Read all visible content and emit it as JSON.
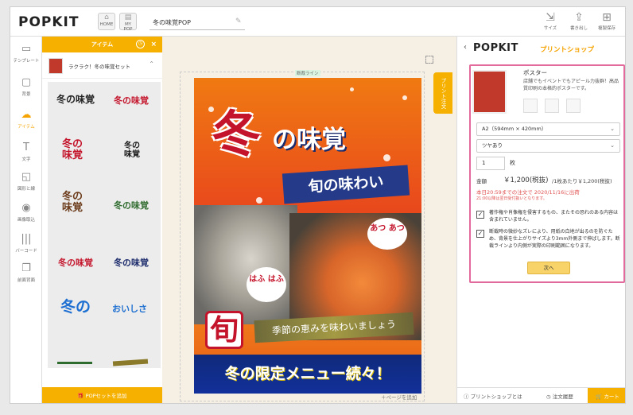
{
  "header": {
    "logo": "POPKIT",
    "home_label": "HOME",
    "mypop_label": "MY POP",
    "doc_title": "冬の味覚POP",
    "tools": [
      {
        "label": "サイズ",
        "icon": "resize-icon"
      },
      {
        "label": "書き出し",
        "icon": "export-icon"
      },
      {
        "label": "複製保存",
        "icon": "duplicate-icon"
      }
    ]
  },
  "rail": {
    "items": [
      {
        "label": "テンプレート",
        "icon": "template-icon",
        "active": false
      },
      {
        "label": "背景",
        "icon": "background-icon",
        "active": false
      },
      {
        "label": "アイテム",
        "icon": "item-icon",
        "active": true
      },
      {
        "label": "文字",
        "icon": "text-icon",
        "active": false
      },
      {
        "label": "図形と線",
        "icon": "shape-icon",
        "active": false
      },
      {
        "label": "画像取込",
        "icon": "image-import-icon",
        "active": false
      },
      {
        "label": "バーコード",
        "icon": "barcode-icon",
        "active": false
      },
      {
        "label": "前面背面",
        "icon": "layer-order-icon",
        "active": false
      }
    ]
  },
  "panel": {
    "title": "アイテム",
    "set_label": "ラクラク！冬の味覚セット",
    "footer": "POPセットを追加",
    "stickers": [
      {
        "text": "冬の味覚",
        "color": "#222222"
      },
      {
        "text": "冬の味覚",
        "color": "#c4142b"
      },
      {
        "text": "冬の味覚",
        "color": "#c4142b"
      },
      {
        "text": "冬の味覚",
        "color": "#1a1a1a"
      },
      {
        "text": "冬の味覚",
        "color": "#6b3b1b"
      },
      {
        "text": "冬の味覚",
        "color": "#2e6b2e"
      },
      {
        "text": "冬の味覚",
        "color": "#c4142b"
      },
      {
        "text": "冬の味覚",
        "color": "#1b2a6b"
      },
      {
        "text": "冬の",
        "color": "#1d6fd1"
      },
      {
        "text": "おいしさ",
        "color": "#1d6fd1"
      }
    ]
  },
  "canvas": {
    "trim_label": "断裁ライン",
    "side_tab": "プリント注文",
    "add_page": "＋ページを追加"
  },
  "poster": {
    "title_a": "冬",
    "title_b": "の味覚",
    "subtitle": "旬の味わい",
    "bubble_1": "あつ あつ",
    "bubble_2": "はふ はふ",
    "badge": "旬",
    "band": "季節の恵みを味わいましょう",
    "bottom": "冬の限定メニュー続々！"
  },
  "shop": {
    "logo": "POPKIT",
    "title": "プリントショップ",
    "product_name": "ポスター",
    "product_desc": "店舗でもイベントでもアピール力抜群！高品質印刷の本格的ポスターです。",
    "size_option": "A2（594mm × 420mm）",
    "finish_option": "ツヤあり",
    "quantity": "1",
    "quantity_unit": "枚",
    "price_label": "金額",
    "price": "￥1,200(税抜)",
    "price_per": "/1枚あたり￥1,200(税抜)",
    "delivery": "本日20:59までの注文で 2020/11/16に出荷",
    "delivery_note": "21:00以降は翌日受付扱いとなります。",
    "check_1": "著作権や肖像権を侵害するもの、またその恐れのある内容は含まれていません。",
    "check_2": "断裁時の微妙なズレにより、用紙の白地が出るのを防ぐため、背景を仕上がりサイズより3mm外側まで伸ばします。断裁ラインより内側が実際の印刷範囲になります。",
    "next_button": "次へ",
    "footer_help": "プリントショップとは",
    "footer_history": "注文履歴",
    "footer_cart": "カート"
  }
}
